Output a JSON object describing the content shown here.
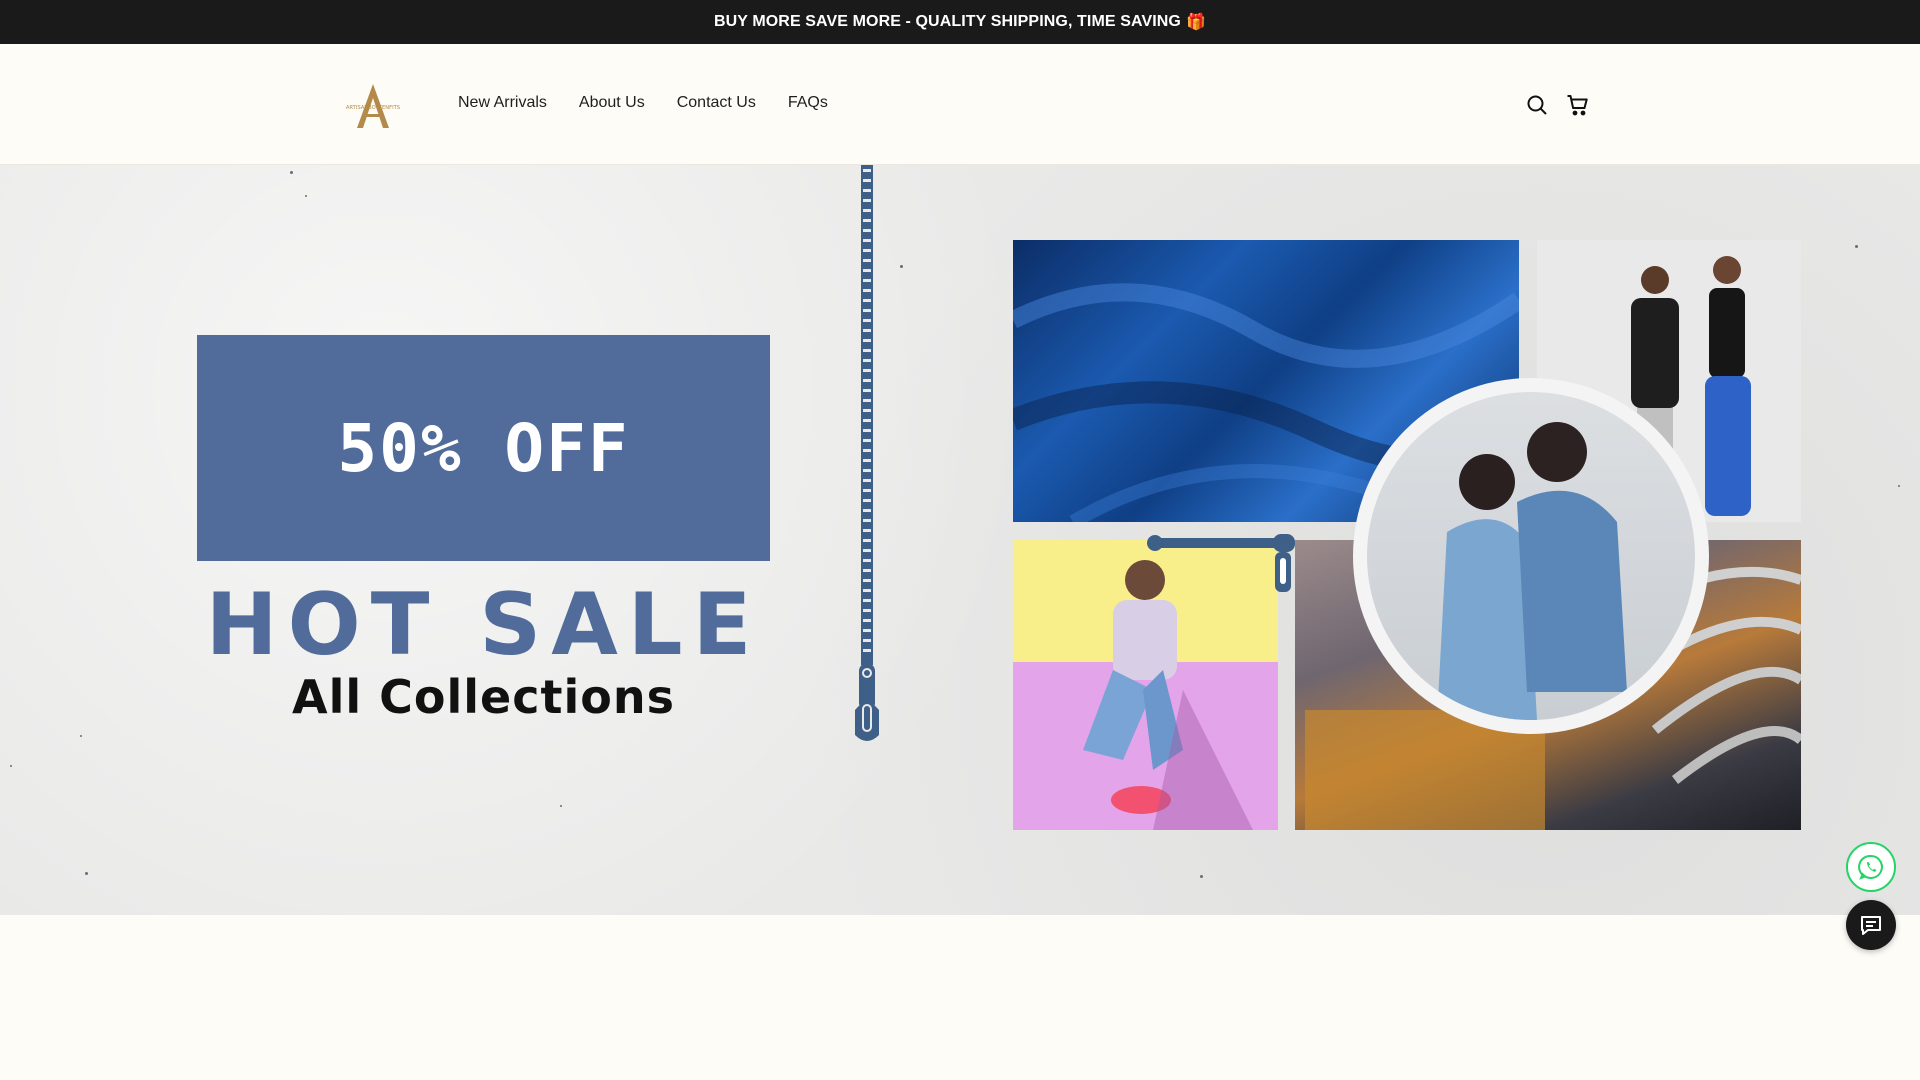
{
  "announcement": {
    "text": "BUY MORE SAVE MORE - QUALITY SHIPPING, TIME SAVING",
    "emoji": "🎁"
  },
  "header": {
    "logo_text": "ARTISANBOTTENFITS",
    "nav": [
      {
        "label": "New Arrivals"
      },
      {
        "label": "About Us"
      },
      {
        "label": "Contact Us"
      },
      {
        "label": "FAQs"
      }
    ],
    "icons": [
      "search-icon",
      "cart-icon"
    ]
  },
  "hero": {
    "offer": "50% OFF",
    "headline": "HOT SALE",
    "subheadline": "All Collections",
    "accent_color": "#516c9a"
  },
  "floating": {
    "whatsapp_icon": "whatsapp-icon",
    "chat_icon": "chat-icon",
    "whatsapp_color": "#25d366"
  }
}
